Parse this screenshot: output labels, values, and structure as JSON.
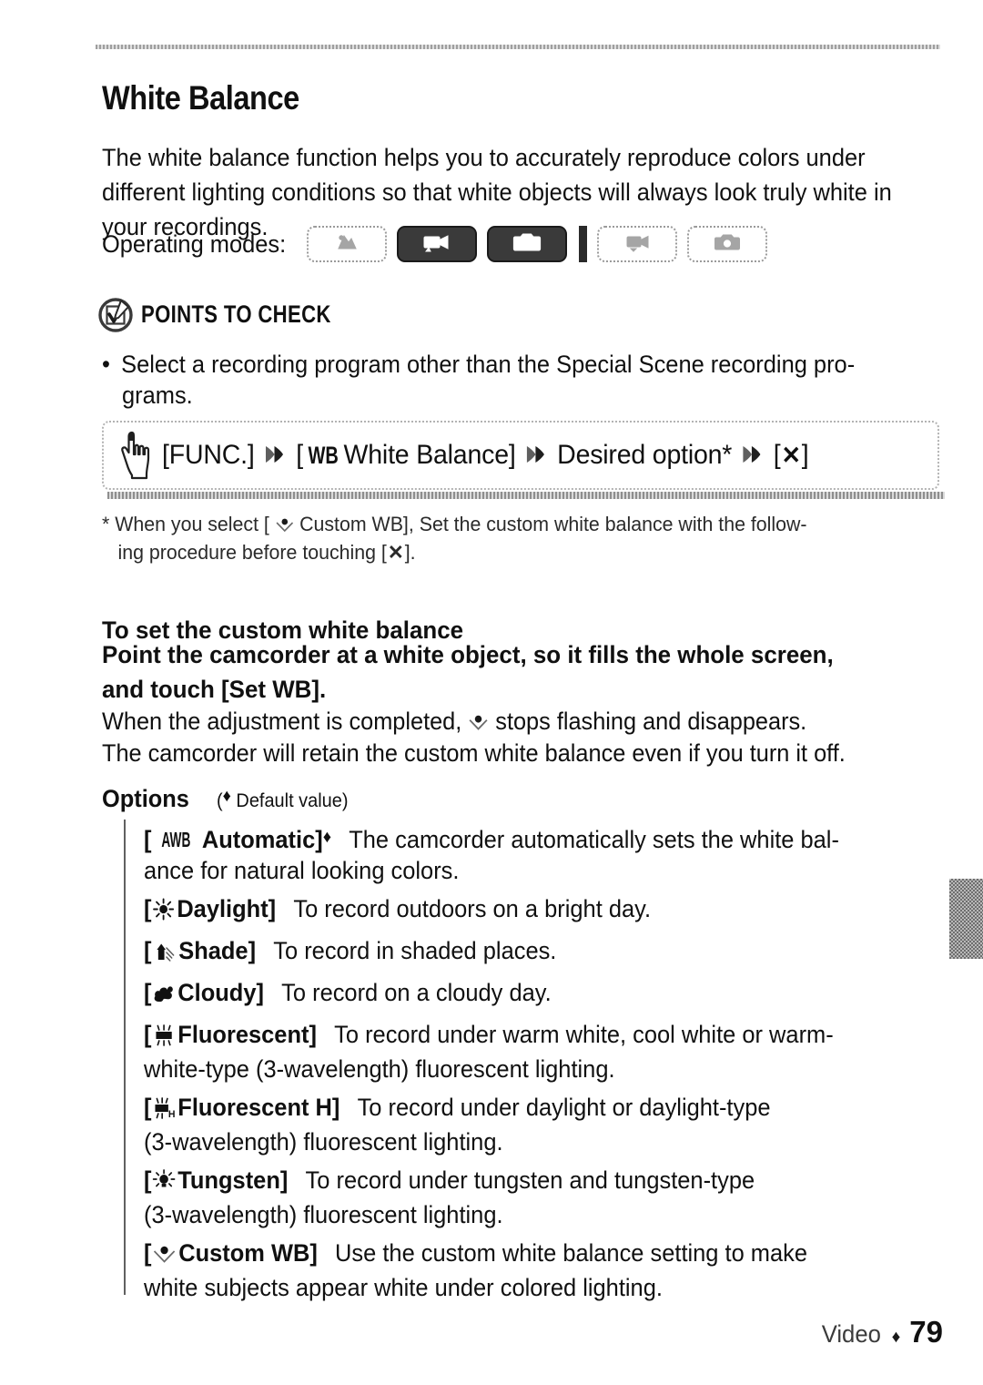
{
  "document": {
    "title": "White Balance",
    "intro": "The white balance function helps you to accurately reproduce colors under different lighting conditions so that white objects will always look truly white in your recordings."
  },
  "operating_modes": {
    "label": "Operating modes:",
    "items": [
      {
        "icon": "auto-mode-icon",
        "state": "inactive"
      },
      {
        "icon": "movie-camera-icon",
        "state": "active"
      },
      {
        "icon": "photo-camera-icon",
        "state": "active"
      },
      {
        "icon": "playback-movie-icon",
        "state": "inactive"
      },
      {
        "icon": "playback-photo-icon",
        "state": "inactive"
      }
    ],
    "separator": "mode-divider"
  },
  "points_to_check": {
    "badge_icon": "check-pencil-badge-icon",
    "title": "POINTS TO CHECK",
    "bullet_marker": "•",
    "bullet_line1": "Select a recording program other than the Special Scene recording pro-",
    "bullet_line2": "grams."
  },
  "procedure": {
    "hand_icon": "pointing-hand-icon",
    "chevron_icon": "double-chevron-right-icon",
    "step1": "[FUNC.]",
    "step2_prefix": "[",
    "step2_tag": "WB",
    "step2_label": "White Balance]",
    "step3": "Desired option*",
    "step4_open": "[",
    "step4_x": "✕",
    "step4_close": "]"
  },
  "footnote": {
    "marker": "*",
    "line1_a": "When you select [",
    "line1_icon": "custom-wb-icon",
    "line1_b": "Custom WB], Set the custom white balance with the follow-",
    "line2_a": "ing procedure before touching [",
    "line2_x": "✕",
    "line2_b": "]."
  },
  "custom_wb": {
    "heading": "To set the custom white balance",
    "lead_line1": "Point the camcorder at a white object, so it fills the whole screen,",
    "lead_line2": "and touch [Set WB].",
    "after_a": "When the adjustment is completed,",
    "after_icon": "custom-wb-icon",
    "after_b": "stops flashing and disappears.",
    "after_line2": "The camcorder will retain the custom white balance even if you turn it off."
  },
  "options": {
    "title": "Options",
    "default_note_open": "(",
    "default_note_diamond": "♦",
    "default_note_text": "Default value)",
    "items": [
      {
        "icon": "awb-icon",
        "icon_text": "AWB",
        "name_open": "[",
        "name": "Automatic]",
        "default_marker": "♦",
        "desc_line1": "The camcorder automatically sets the white bal-",
        "desc_line2": "ance for natural looking colors."
      },
      {
        "icon": "sun-daylight-icon",
        "name_open": "[",
        "name": "Daylight]",
        "default_marker": "",
        "desc_line1": "To record outdoors on a bright day.",
        "desc_line2": ""
      },
      {
        "icon": "shade-icon",
        "name_open": "[",
        "name": "Shade]",
        "default_marker": "",
        "desc_line1": "To record in shaded places.",
        "desc_line2": ""
      },
      {
        "icon": "cloud-icon",
        "name_open": "[",
        "name": "Cloudy]",
        "default_marker": "",
        "desc_line1": "To record on a cloudy day.",
        "desc_line2": ""
      },
      {
        "icon": "fluorescent-icon",
        "name_open": "[",
        "name": "Fluorescent]",
        "default_marker": "",
        "desc_line1": "To record under warm white, cool white or warm-",
        "desc_line2": "white-type (3-wavelength) fluorescent lighting."
      },
      {
        "icon": "fluorescent-h-icon",
        "name_open": "[",
        "name": "Fluorescent H]",
        "default_marker": "",
        "desc_line1": "To record under daylight or daylight-type",
        "desc_line2": "(3-wavelength) fluorescent lighting."
      },
      {
        "icon": "tungsten-icon",
        "name_open": "[",
        "name": "Tungsten]",
        "default_marker": "",
        "desc_line1": "To record under tungsten and tungsten-type",
        "desc_line2": "(3-wavelength) fluorescent lighting."
      },
      {
        "icon": "custom-wb-icon",
        "name_open": "[",
        "name": "Custom WB]",
        "default_marker": "",
        "desc_line1": "Use the custom white balance setting to make",
        "desc_line2": "white subjects appear white under colored lighting."
      }
    ]
  },
  "side_tab": {
    "name": "chapter-thumb-tab"
  },
  "footer": {
    "section": "Video",
    "diamond": "♦",
    "page": "79"
  }
}
